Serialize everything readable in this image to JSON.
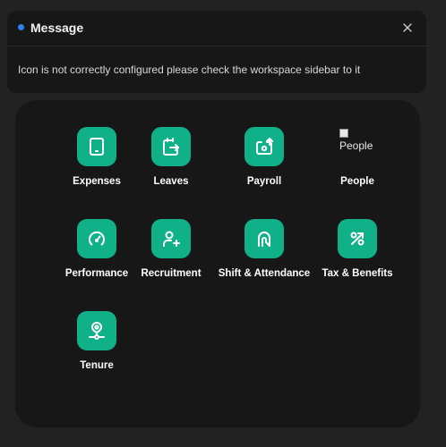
{
  "message": {
    "title": "Message",
    "body": "Icon is not correctly configured please check the workspace sidebar to it",
    "close_symbol": "×",
    "accent": "#2f80ed"
  },
  "workspace": {
    "tile_color": "#10b088",
    "tiles": [
      {
        "label": "Expenses",
        "icon": "tablet-icon"
      },
      {
        "label": "Leaves",
        "icon": "calendar-exit-icon"
      },
      {
        "label": "Payroll",
        "icon": "wallet-upload-icon"
      },
      {
        "label": "People",
        "icon": "broken-image-icon",
        "alt": "People"
      },
      {
        "label": "Performance",
        "icon": "gauge-icon"
      },
      {
        "label": "Recruitment",
        "icon": "user-add-icon"
      },
      {
        "label": "Shift & Attendance",
        "icon": "touch-icon"
      },
      {
        "label": "Tax & Benefits",
        "icon": "percent-icon"
      },
      {
        "label": "Tenure",
        "icon": "map-pin-icon"
      }
    ]
  }
}
